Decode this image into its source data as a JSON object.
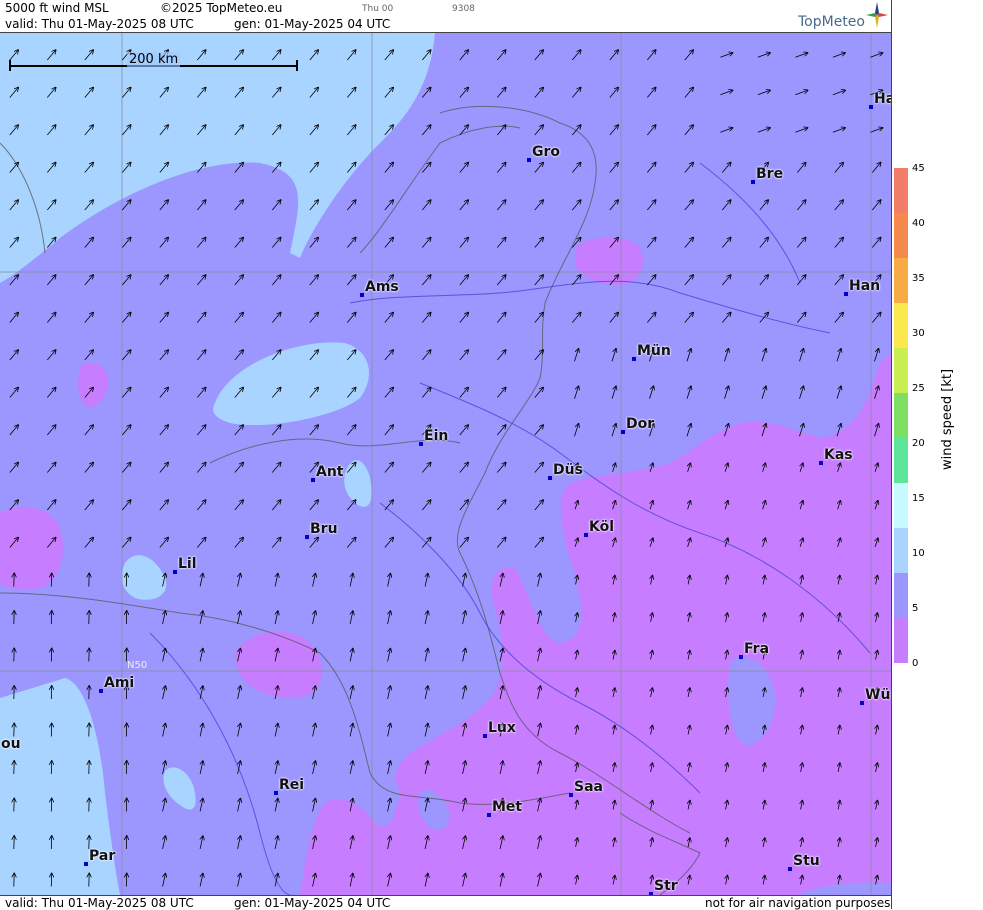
{
  "header": {
    "product": "5000 ft wind MSL",
    "copyright": "©2025 TopMeteo.eu",
    "small_day": "Thu 00",
    "small_code": "9308",
    "valid": "valid:  Thu  01-May-2025  08 UTC",
    "gen": "gen: 01-May-2025 04 UTC",
    "brand": "TopMeteo"
  },
  "footer": {
    "valid": "valid:  Thu  01-May-2025  08 UTC",
    "gen": "gen: 01-May-2025 04 UTC",
    "disclaimer": "not for air navigation purposes"
  },
  "scale_bar": {
    "label": "200 km"
  },
  "graticule_label": "N50",
  "legend": {
    "title": "wind  speed  [kt]",
    "ticks": [
      "45",
      "40",
      "35",
      "30",
      "25",
      "20",
      "15",
      "10",
      "5",
      "0"
    ],
    "colors": [
      "#f27c66",
      "#f58a4c",
      "#f8aa45",
      "#fbe84c",
      "#c9ee52",
      "#7ee062",
      "#5ee59c",
      "#c8fbff",
      "#a8d4ff",
      "#9c96ff",
      "#c77dff"
    ]
  },
  "cities": [
    {
      "name": "Gro"
    },
    {
      "name": "Bre"
    },
    {
      "name": "Ha"
    },
    {
      "name": "Ams"
    },
    {
      "name": "Han"
    },
    {
      "name": "Mün"
    },
    {
      "name": "Ein"
    },
    {
      "name": "Dor"
    },
    {
      "name": "Ant"
    },
    {
      "name": "Düs"
    },
    {
      "name": "Kas"
    },
    {
      "name": "Bru"
    },
    {
      "name": "Köl"
    },
    {
      "name": "Lil"
    },
    {
      "name": "Fra"
    },
    {
      "name": "Ami"
    },
    {
      "name": "Wü"
    },
    {
      "name": "Lux"
    },
    {
      "name": "ou"
    },
    {
      "name": "Rei"
    },
    {
      "name": "Saa"
    },
    {
      "name": "Met"
    },
    {
      "name": "Stu"
    },
    {
      "name": "Par"
    },
    {
      "name": "Str"
    }
  ],
  "colors": {
    "wind_0_5": "#c77dff",
    "wind_5_10": "#9c96ff",
    "wind_10_15": "#a8d4ff"
  }
}
